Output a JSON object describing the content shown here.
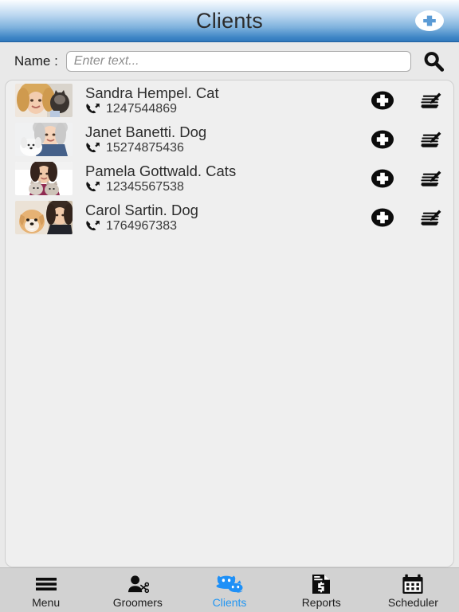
{
  "header": {
    "title": "Clients",
    "add_button_name": "add-client-button"
  },
  "search": {
    "label": "Name :",
    "placeholder": "Enter text...",
    "value": "",
    "go_button_name": "search-button"
  },
  "clients": [
    {
      "name": "Sandra Hempel. Cat",
      "phone": "1247544869",
      "avatar_alt": "woman-with-cat-photo"
    },
    {
      "name": "Janet Banetti. Dog",
      "phone": "15274875436",
      "avatar_alt": "woman-with-white-dog-photo"
    },
    {
      "name": "Pamela Gottwald. Cats",
      "phone": "12345567538",
      "avatar_alt": "woman-with-two-cats-photo"
    },
    {
      "name": "Carol Sartin. Dog",
      "phone": "1764967383",
      "avatar_alt": "woman-with-tan-dog-photo"
    }
  ],
  "row_actions": {
    "add_label": "add-appointment-icon",
    "notes_label": "edit-notes-icon"
  },
  "tabs": [
    {
      "label": "Menu",
      "icon": "hamburger-icon",
      "active": false
    },
    {
      "label": "Groomers",
      "icon": "groomer-icon",
      "active": false
    },
    {
      "label": "Clients",
      "icon": "pets-icon",
      "active": true
    },
    {
      "label": "Reports",
      "icon": "report-icon",
      "active": false
    },
    {
      "label": "Scheduler",
      "icon": "calendar-icon",
      "active": false
    }
  ],
  "colors": {
    "header_blue": "#2f78bc",
    "accent_blue": "#2196f3",
    "page_bg": "#e9e9e9",
    "panel_bg": "#efefef",
    "tabbar_bg": "#d2d2d2",
    "text_dark": "#2d2d2d"
  }
}
